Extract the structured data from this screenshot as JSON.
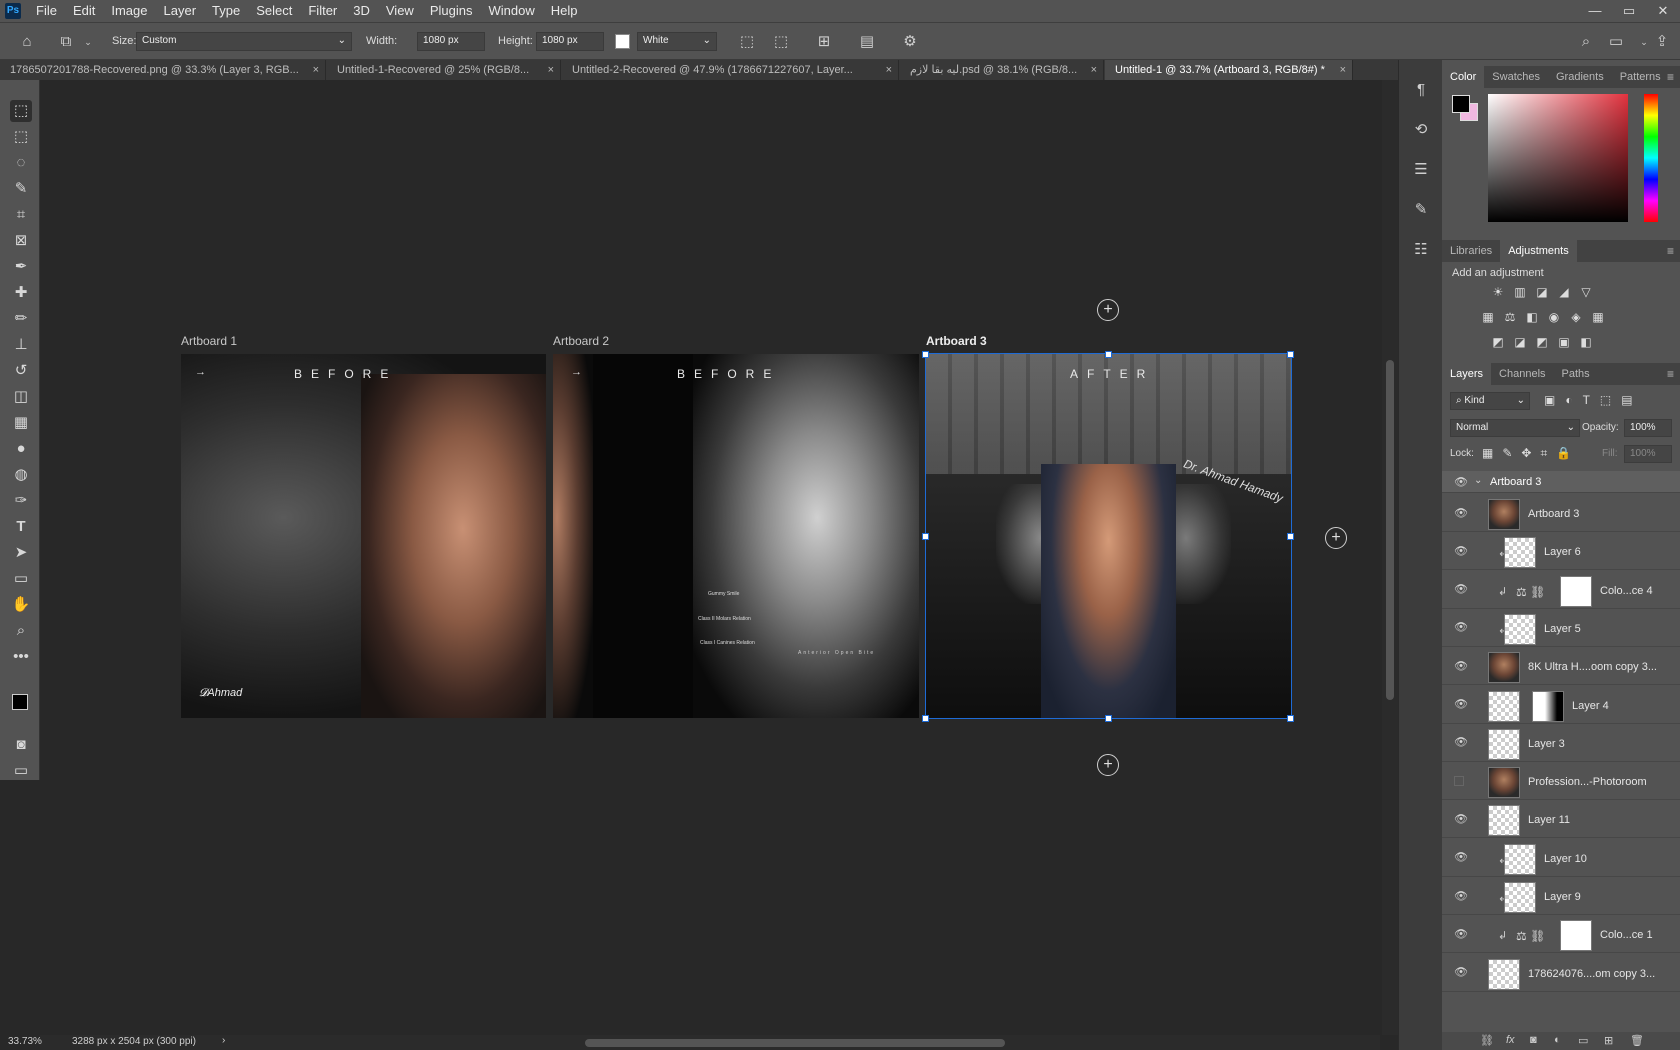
{
  "menubar": {
    "logo": "Ps",
    "items": [
      "File",
      "Edit",
      "Image",
      "Layer",
      "Type",
      "Select",
      "Filter",
      "3D",
      "View",
      "Plugins",
      "Window",
      "Help"
    ],
    "window_controls": [
      "—",
      "▭",
      "✕"
    ]
  },
  "options_bar": {
    "size_label": "Size:",
    "size_value": "Custom",
    "width_label": "Width:",
    "width_value": "1080 px",
    "height_label": "Height:",
    "height_value": "1080 px",
    "bg_value": "White"
  },
  "tabs": [
    {
      "label": "1786507201788-Recovered.png @ 33.3% (Layer 3, RGB..."
    },
    {
      "label": "Untitled-1-Recovered @ 25% (RGB/8..."
    },
    {
      "label": "Untitled-2-Recovered @ 47.9% (1786671227607, Layer..."
    },
    {
      "label": "ليه بقا لازم.psd @ 38.1% (RGB/8..."
    },
    {
      "label": "Untitled-1 @ 33.7% (Artboard 3, RGB/8#) *"
    }
  ],
  "artboards": [
    {
      "label": "Artboard 1",
      "word": "BEFORE",
      "arrow": "→",
      "logo_text": "𝓓Ahmad"
    },
    {
      "label": "Artboard 2",
      "word": "BEFORE",
      "arrow": "→",
      "annotations": [
        "Gummy Smile",
        "Class II Molars Relation",
        "Class I Canines Relation"
      ],
      "footer": "Anterior Open Bite"
    },
    {
      "label": "Artboard 3",
      "word": "AFTER",
      "signature": "Dr. Ahmad Hamady"
    }
  ],
  "status": {
    "zoom": "33.73%",
    "doc_size": "3288 px x 2504 px (300 ppi)"
  },
  "color_panel": {
    "tabs": [
      "Color",
      "Swatches",
      "Gradients",
      "Patterns"
    ],
    "foreground": "#000000",
    "background": "#f0b8e0"
  },
  "adjustments_panel": {
    "tabs": [
      "Libraries",
      "Adjustments"
    ],
    "title": "Add an adjustment",
    "icons": [
      "brightness-icon",
      "levels-icon",
      "curves-icon",
      "exposure-icon",
      "vibrance-icon",
      "hsl-icon",
      "color-balance-icon",
      "bw-icon",
      "photo-filter-icon",
      "channel-mixer-icon",
      "color-lookup-icon",
      "invert-icon",
      "posterize-icon",
      "threshold-icon",
      "gradient-map-icon",
      "selective-color-icon"
    ]
  },
  "layers_panel": {
    "tabs": [
      "Layers",
      "Channels",
      "Paths"
    ],
    "kind_label": "Kind",
    "blend_mode": "Normal",
    "opacity_label": "Opacity:",
    "opacity_value": "100%",
    "lock_label": "Lock:",
    "fill_label": "Fill:",
    "fill_value": "100%",
    "group": "Artboard 3",
    "layers": [
      {
        "name": "Artboard 3",
        "thumb": "photo",
        "clip": false,
        "adj": false,
        "visible": true
      },
      {
        "name": "Layer 6",
        "thumb": "checker",
        "clip": true,
        "adj": false,
        "visible": true
      },
      {
        "name": "Colo...ce 4",
        "thumb": "white",
        "clip": true,
        "adj": true,
        "visible": true
      },
      {
        "name": "Layer 5",
        "thumb": "checker",
        "clip": true,
        "adj": false,
        "visible": true
      },
      {
        "name": "8K Ultra H....oom copy 3...",
        "thumb": "photo",
        "clip": false,
        "adj": false,
        "visible": true
      },
      {
        "name": "Layer 4",
        "thumb": "checker",
        "mask": true,
        "clip": false,
        "adj": false,
        "visible": true
      },
      {
        "name": "Layer 3",
        "thumb": "checker",
        "clip": false,
        "adj": false,
        "visible": true
      },
      {
        "name": "Profession...-Photoroom",
        "thumb": "photo",
        "clip": false,
        "adj": false,
        "visible": false
      },
      {
        "name": "Layer 11",
        "thumb": "checker",
        "clip": false,
        "adj": false,
        "visible": true
      },
      {
        "name": "Layer 10",
        "thumb": "checker",
        "clip": true,
        "adj": false,
        "visible": true
      },
      {
        "name": "Layer 9",
        "thumb": "checker",
        "clip": true,
        "adj": false,
        "visible": true
      },
      {
        "name": "Colo...ce 1",
        "thumb": "white",
        "clip": true,
        "adj": true,
        "visible": true
      },
      {
        "name": "178624076....om copy 3...",
        "thumb": "checker",
        "clip": false,
        "adj": false,
        "visible": true
      }
    ]
  },
  "colors": {
    "accent": "#1e6bd6",
    "panel_bg": "#535353",
    "canvas_bg": "#282828"
  }
}
